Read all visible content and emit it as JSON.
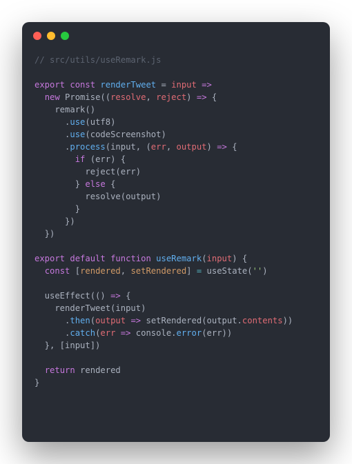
{
  "traffic_lights": {
    "red": "#ff5f56",
    "yellow": "#ffbd2e",
    "green": "#27c93f"
  },
  "tokens": {
    "l1_cmt": "// src/utils/useRemark.js",
    "export": "export",
    "const": "const",
    "renderTweet": "renderTweet",
    "eq": " = ",
    "input": "input",
    "arrow": " =>",
    "new": "new",
    "Promise": " Promise((",
    "resolve": "resolve",
    "comma": ", ",
    "reject": "reject",
    "rparen_arrow_brace": ") ",
    "arrow2": "=>",
    "open_brace": " {",
    "remark_line": "    remark()",
    "dot": ".",
    "use": "use",
    "utf8_arg": "(utf8)",
    "codeScreenshot_arg": "(codeScreenshot)",
    "process": "process",
    "process_open": "(input, (",
    "err": "err",
    "output": "output",
    "process_close": ") ",
    "if": "if",
    "if_open": " (err) {",
    "reject_line": "          reject(err)",
    "close_else": "        } ",
    "else": "else",
    "else_open": " {",
    "resolve_line": "          resolve(output)",
    "close1": "        }",
    "close2": "      })",
    "close3": "  })",
    "default": "default",
    "function": "function",
    "useRemark": "useRemark",
    "useRemark_open": "(",
    "useRemark_close": ") {",
    "bracket_open": " [",
    "rendered": "rendered",
    "setRendered": "setRendered",
    "bracket_close": "] ",
    "useState": " useState(",
    "empty_str": "''",
    "useState_close": ")",
    "useEffect_line": "  useEffect(() ",
    "lbrace": " {",
    "renderTweet_call": "    renderTweet(input)",
    "then": "then",
    "then_open": "(",
    "then_arrow": " ",
    "setRendered_call": " setRendered(output.",
    "contents": "contents",
    "then_close": "))",
    "catch": "catch",
    "catch_open": "(",
    "catch_arrow": " ",
    "console": " console.",
    "error": "error",
    "error_call": "(err))",
    "useEffect_close": "  }, [input])",
    "return": "return",
    "rendered_ret": " rendered",
    "final_close": "}",
    "indent2": "  ",
    "indent3": "      ",
    "indent4": "        ",
    "sp": " "
  }
}
